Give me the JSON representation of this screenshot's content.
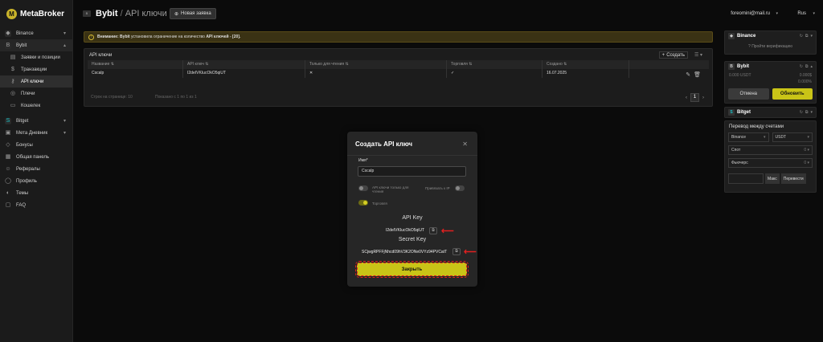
{
  "brand": {
    "name": "MetaBroker"
  },
  "sidebar": {
    "items": [
      {
        "label": "Binance"
      },
      {
        "label": "Bybit"
      },
      {
        "label": "Заявки и позиции"
      },
      {
        "label": "Транзакции"
      },
      {
        "label": "API ключи"
      },
      {
        "label": "Плечи"
      },
      {
        "label": "Кошелек"
      },
      {
        "label": "Bitget"
      },
      {
        "label": "Мета Дневник"
      },
      {
        "label": "Бонусы"
      },
      {
        "label": "Общая панель"
      },
      {
        "label": "Рефералы"
      },
      {
        "label": "Профиль"
      },
      {
        "label": "Темы"
      },
      {
        "label": "FAQ"
      }
    ]
  },
  "header": {
    "exchange": "Bybit",
    "separator": "/",
    "subtitle": "API ключи",
    "new_request": "Новая заявка",
    "email": "foreomini@mail.ru",
    "lang": "Rus"
  },
  "warning": {
    "prefix": "Внимание: Bybit",
    "text": "установила ограничение на количество",
    "bold": "API ключей - [20]."
  },
  "keys_panel": {
    "title": "API ключи",
    "create": "Создать",
    "columns": [
      "Название",
      "API ключ",
      "Только для чтения",
      "Торговля",
      "Создано"
    ],
    "row": {
      "name": "Cscalp",
      "key": "I2deIVKIucOkO5qiUT",
      "read_only": "✕",
      "trade": "✓",
      "created": "16.07.2025"
    },
    "per_page": "Строк на странице: 10",
    "shown": "Показано с 1 по 1 из 1",
    "page": "1"
  },
  "right_cards": {
    "binance": {
      "name": "Binance",
      "verify": "Пройти верификацию"
    },
    "bybit": {
      "name": "Bybit",
      "usdt": "0.000 USDT",
      "usd": "0.000$",
      "pct": "0.000%",
      "cancel": "Отмена",
      "update": "Обновить"
    },
    "bitget": {
      "name": "Bitget"
    },
    "transfer": {
      "title": "Перевод между счетами",
      "exchange": "Binance",
      "currency": "USDT",
      "spot_label": "Спот",
      "spot_value": "0",
      "futures_label": "Фьючерс",
      "futures_value": "0",
      "max": "Макс",
      "submit": "Перевести"
    }
  },
  "modal": {
    "title": "Создать API ключ",
    "name_label": "Имя*",
    "name_value": "Cscalp",
    "read_only_label": "API ключи только для чтения",
    "ip_label": "Привязать к IP",
    "trade_label": "Торговля",
    "api_key_title": "API Key",
    "api_key_value": "I2deIVKIucOkO5qiUT",
    "secret_title": "Secret Key",
    "secret_value": "SCjwgRPFFjNhcd09hV3K2ONe0VYz94PVCatT",
    "close_button": "Закрыть"
  },
  "colors": {
    "accent": "#c9c417",
    "highlight": "#e02020"
  }
}
